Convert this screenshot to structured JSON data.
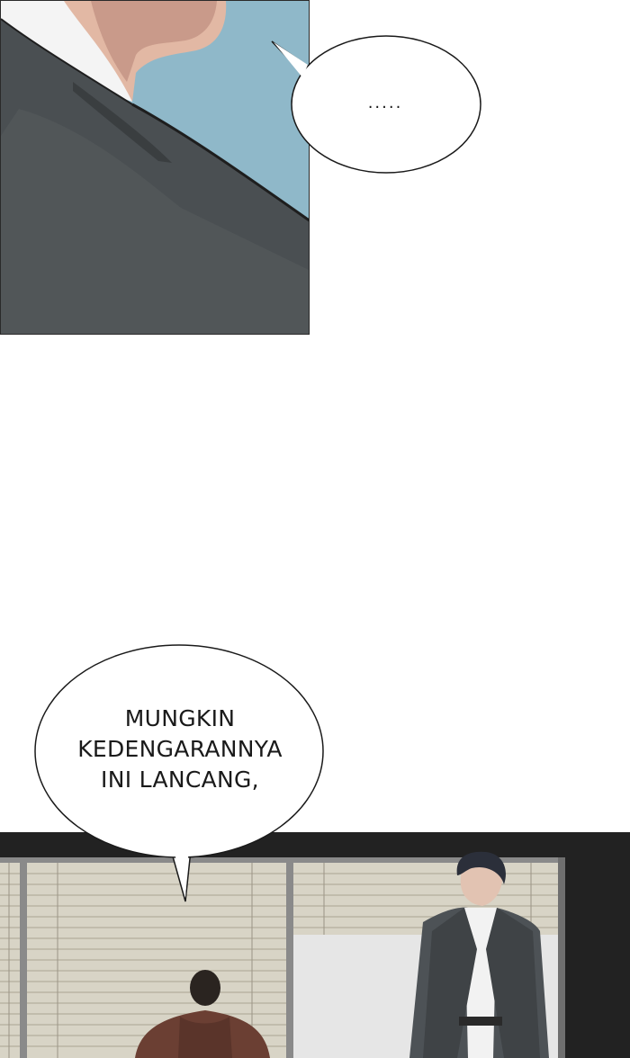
{
  "bubbles": {
    "top_text": ".....",
    "bottom_text": "MUNGKIN\nKEDENGARANNYA\nINI LANCANG,"
  },
  "colors": {
    "sky": "#8fb8c9",
    "jacket": "#4a4f52",
    "skin": "#e2b8a4",
    "office_bg": "#222222",
    "blinds": "#d8d4c6",
    "wall": "#e6e6e6"
  }
}
